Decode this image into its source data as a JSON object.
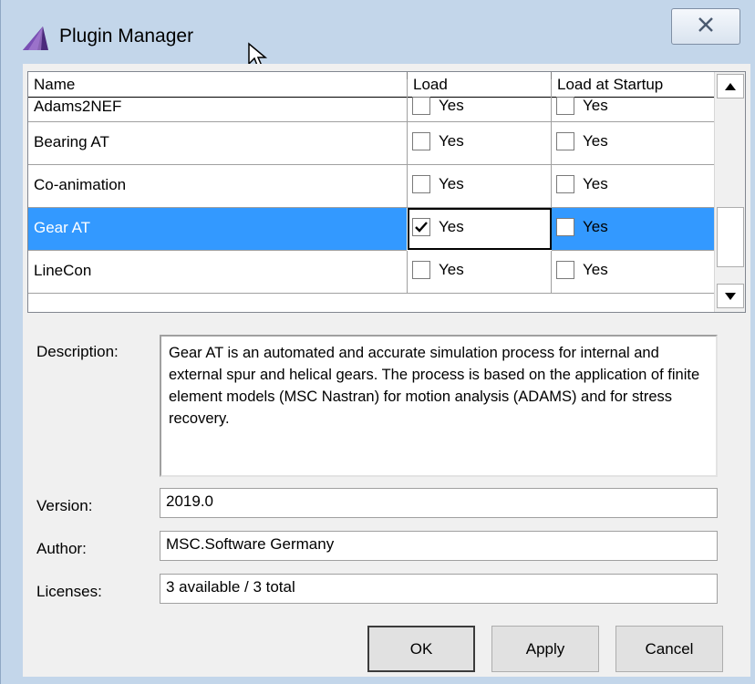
{
  "window": {
    "title": "Plugin Manager",
    "close_glyph": "✕"
  },
  "grid": {
    "columns": [
      "Name",
      "Load",
      "Load at Startup"
    ],
    "rows": [
      {
        "name": "Adams2NEF",
        "load": false,
        "load_label": "Yes",
        "startup": false,
        "startup_label": "Yes"
      },
      {
        "name": "Bearing AT",
        "load": false,
        "load_label": "Yes",
        "startup": false,
        "startup_label": "Yes"
      },
      {
        "name": "Co-animation",
        "load": false,
        "load_label": "Yes",
        "startup": false,
        "startup_label": "Yes"
      },
      {
        "name": "Gear AT",
        "load": true,
        "load_label": "Yes",
        "startup": false,
        "startup_label": "Yes",
        "selected": true
      },
      {
        "name": "LineCon",
        "load": false,
        "load_label": "Yes",
        "startup": false,
        "startup_label": "Yes"
      }
    ]
  },
  "details": {
    "description_label": "Description:",
    "description": "Gear AT is an automated and accurate simulation process for internal and external spur and helical gears. The process is based on the application of finite element models (MSC Nastran) for motion analysis (ADAMS) and for stress recovery.",
    "version_label": "Version:",
    "version": "2019.0",
    "author_label": "Author:",
    "author": "MSC.Software Germany",
    "licenses_label": "Licenses:",
    "licenses": "3 available / 3 total"
  },
  "buttons": {
    "ok": "OK",
    "apply": "Apply",
    "cancel": "Cancel"
  },
  "colors": {
    "selection": "#3399ff",
    "frame": "#c3d6ea",
    "dialog": "#f0f0f0"
  },
  "icons": [
    "app-logo-icon",
    "close-icon",
    "mouse-cursor-icon",
    "checkmark-icon",
    "scroll-up-arrow-icon",
    "scroll-down-arrow-icon"
  ]
}
